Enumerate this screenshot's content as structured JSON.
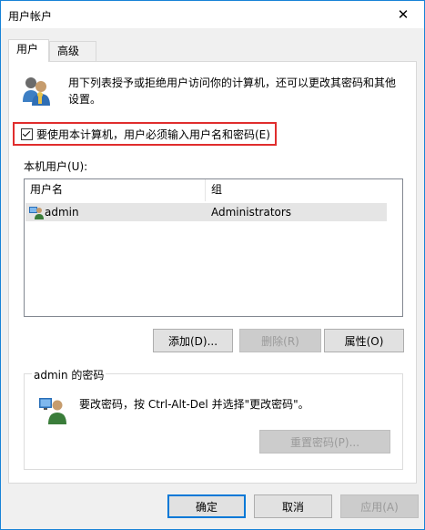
{
  "window": {
    "title": "用户帐户",
    "close_symbol": "✕"
  },
  "tabs": [
    {
      "label": "用户",
      "active": true
    },
    {
      "label": "高级",
      "active": false
    }
  ],
  "description": "用下列表授予或拒绝用户访问你的计算机，还可以更改其密码和其他设置。",
  "checkbox": {
    "label": "要使用本计算机，用户必须输入用户名和密码(E)",
    "checked": true
  },
  "users_section": {
    "label": "本机用户(U):",
    "columns": [
      "用户名",
      "组"
    ],
    "rows": [
      {
        "name": "admin",
        "group": "Administrators",
        "icon": "user-icon"
      }
    ]
  },
  "buttons": {
    "add": "添加(D)...",
    "delete": "删除(R)",
    "properties": "属性(O)"
  },
  "password_group": {
    "title": "admin 的密码",
    "text": "要改密码，按 Ctrl-Alt-Del 并选择\"更改密码\"。",
    "reset_button": "重置密码(P)..."
  },
  "footer": {
    "ok": "确定",
    "cancel": "取消",
    "apply": "应用(A)"
  },
  "colors": {
    "highlight_border": "#e02d2d",
    "window_border": "#1883d7",
    "default_button_border": "#0078d7"
  }
}
